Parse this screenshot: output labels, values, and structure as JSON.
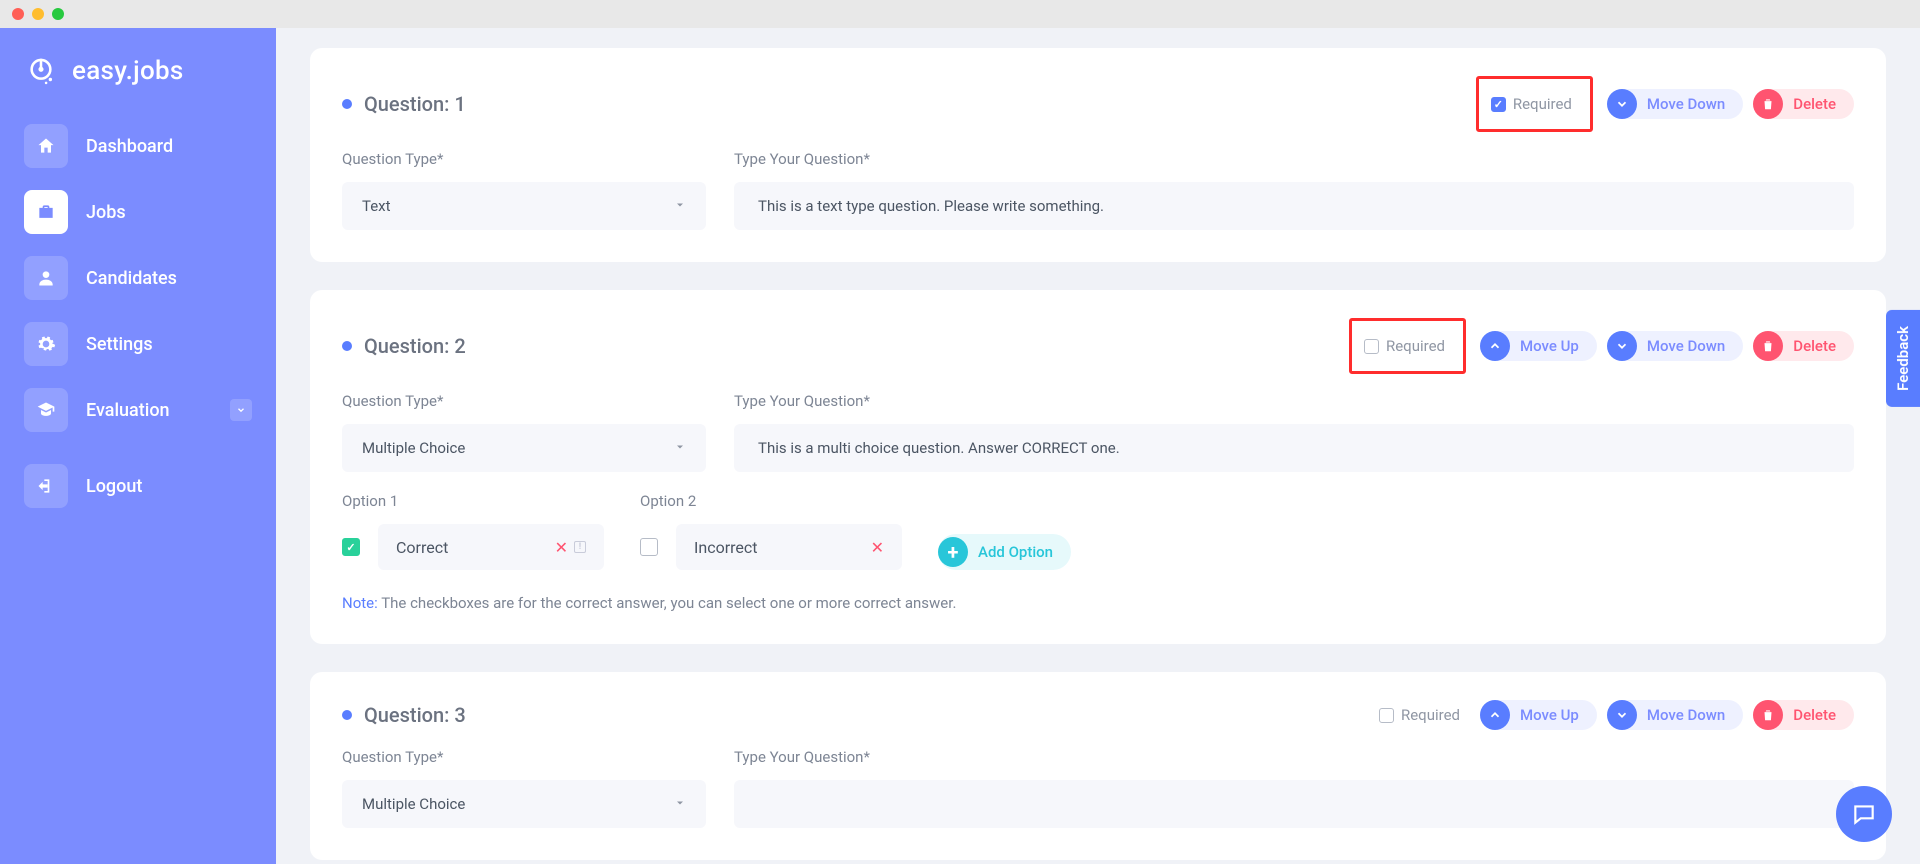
{
  "logo": {
    "text": "easy.jobs"
  },
  "sidebar": {
    "items": [
      {
        "label": "Dashboard",
        "icon": "home"
      },
      {
        "label": "Jobs",
        "icon": "briefcase"
      },
      {
        "label": "Candidates",
        "icon": "user"
      },
      {
        "label": "Settings",
        "icon": "gear"
      },
      {
        "label": "Evaluation",
        "icon": "cap"
      },
      {
        "label": "Logout",
        "icon": "logout"
      }
    ]
  },
  "labels": {
    "question_type": "Question Type*",
    "type_your_question": "Type Your Question*",
    "required": "Required",
    "move_up": "Move Up",
    "move_down": "Move Down",
    "delete": "Delete",
    "add_option": "Add Option",
    "note_label": "Note:",
    "note_text": "The checkboxes are for the correct answer, you can select one or more correct answer.",
    "option1": "Option 1",
    "option2": "Option 2",
    "feedback": "Feedback"
  },
  "questions": [
    {
      "title": "Question: 1",
      "required": true,
      "type": "Text",
      "text": "This is a text type question. Please write something.",
      "highlight_required": true
    },
    {
      "title": "Question: 2",
      "required": false,
      "type": "Multiple Choice",
      "text": "This is a multi choice question. Answer CORRECT one.",
      "highlight_required": true,
      "options": [
        {
          "label": "Correct",
          "checked": true,
          "has_warn": true
        },
        {
          "label": "Incorrect",
          "checked": false,
          "has_warn": false
        }
      ]
    },
    {
      "title": "Question: 3",
      "required": false,
      "type": "Multiple Choice",
      "text": "",
      "highlight_required": false
    }
  ]
}
